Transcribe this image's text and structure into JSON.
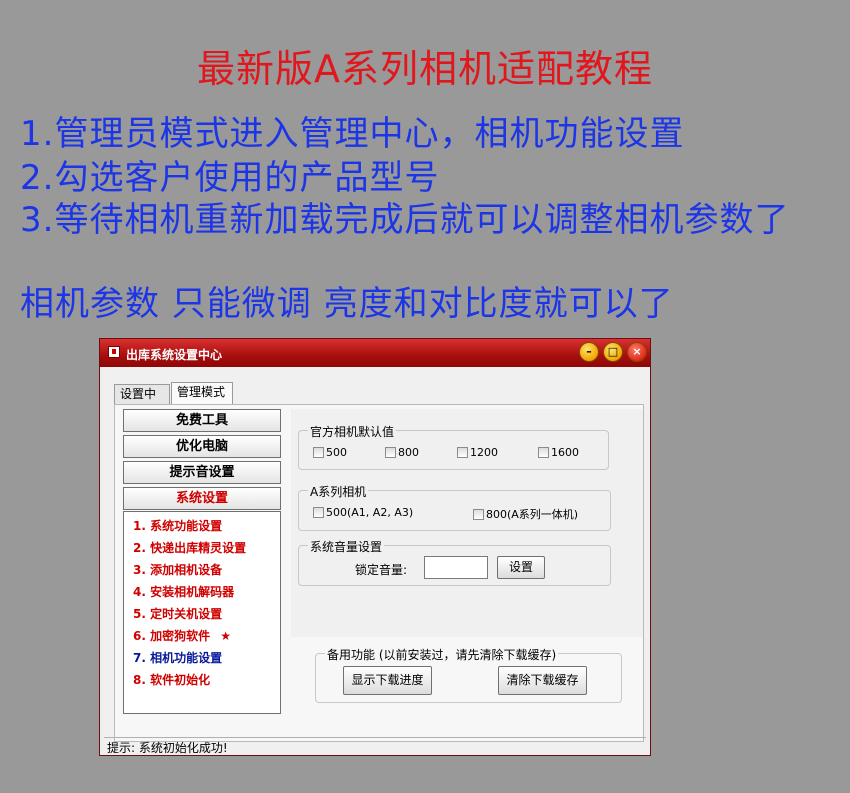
{
  "headline": "最新版A系列相机适配教程",
  "steps": {
    "s1": "1.管理员模式进入管理中心，相机功能设置",
    "s2": "2.勾选客户使用的产品型号",
    "s3": "3.等待相机重新加载完成后就可以调整相机参数了",
    "note": "相机参数 只能微调 亮度和对比度就可以了"
  },
  "window": {
    "title": "出库系统设置中心",
    "min": "–",
    "max": "□",
    "close": "×"
  },
  "tabs": [
    "设置中心",
    "管理模式"
  ],
  "menu_buttons": [
    "免费工具",
    "优化电脑",
    "提示音设置",
    "系统设置"
  ],
  "sub_items": [
    "1. 系统功能设置",
    "2. 快递出库精灵设置",
    "3. 添加相机设备",
    "4. 安装相机解码器",
    "5. 定时关机设置",
    "6. 加密狗软件",
    "7. 相机功能设置",
    "8. 软件初始化"
  ],
  "star": "★",
  "official_group": {
    "title": "官方相机默认值",
    "options": [
      "500",
      "800",
      "1200",
      "1600"
    ]
  },
  "a_series_group": {
    "title": "A系列相机",
    "options": [
      "500(A1, A2, A3)",
      "800(A系列一体机)"
    ]
  },
  "volume_group": {
    "title": "系统音量设置",
    "label": "锁定音量:",
    "value": "",
    "button": "设置"
  },
  "backup_group": {
    "title": "备用功能 (以前安装过，请先清除下载缓存)",
    "show_button": "显示下载进度",
    "clear_button": "清除下载缓存"
  },
  "status": "提示: 系统初始化成功!",
  "colors": {
    "headline": "#e0181e",
    "steps": "#1c35e6",
    "menu_active": "#d00000",
    "sub_active": "#0a1a9a"
  }
}
